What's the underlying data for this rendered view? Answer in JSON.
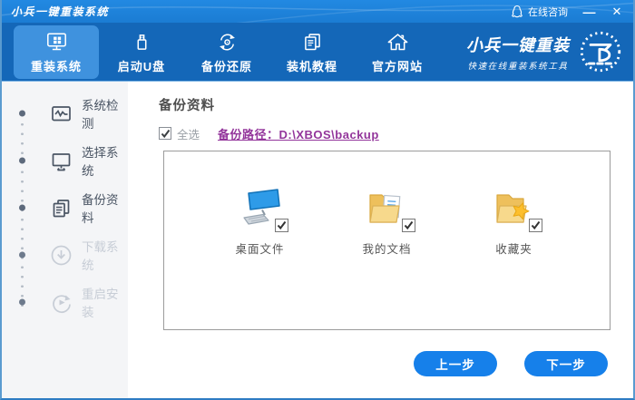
{
  "window": {
    "title": "小兵一键重装系统",
    "online_service": "在线咨询",
    "minimize": "—",
    "close": "✕"
  },
  "nav": {
    "items": [
      {
        "label": "重装系统",
        "icon": "monitor-grid-icon",
        "active": true
      },
      {
        "label": "启动U盘",
        "icon": "usb-drive-icon",
        "active": false
      },
      {
        "label": "备份还原",
        "icon": "backup-restore-icon",
        "active": false
      },
      {
        "label": "装机教程",
        "icon": "tutorial-docs-icon",
        "active": false
      },
      {
        "label": "官方网站",
        "icon": "home-icon",
        "active": false
      }
    ],
    "brand": {
      "name": "小兵一键重装",
      "slogan": "快速在线重装系统工具"
    }
  },
  "sidebar": {
    "steps": [
      {
        "label": "系统检测",
        "state": "done"
      },
      {
        "label": "选择系统",
        "state": "done"
      },
      {
        "label": "备份资料",
        "state": "active"
      },
      {
        "label": "下载系统",
        "state": "pending"
      },
      {
        "label": "重启安装",
        "state": "pending"
      }
    ]
  },
  "main": {
    "title": "备份资料",
    "select_all_label": "全选",
    "select_all_checked": true,
    "backup_path_link": "备份路径：D:\\XBOS\\backup",
    "items": [
      {
        "label": "桌面文件",
        "icon": "desktop-computer-icon",
        "checked": true
      },
      {
        "label": "我的文档",
        "icon": "documents-folder-icon",
        "checked": true
      },
      {
        "label": "收藏夹",
        "icon": "favorites-folder-icon",
        "checked": true
      }
    ],
    "prev_button": "上一步",
    "next_button": "下一步"
  },
  "colors": {
    "titlebar": "#1b7cd3",
    "nav": "#1467b8",
    "nav_active": "#3f92de",
    "button": "#1680ea",
    "link": "#93359b",
    "step_text": "#4a5564",
    "step_pending": "#c7cdd6"
  }
}
